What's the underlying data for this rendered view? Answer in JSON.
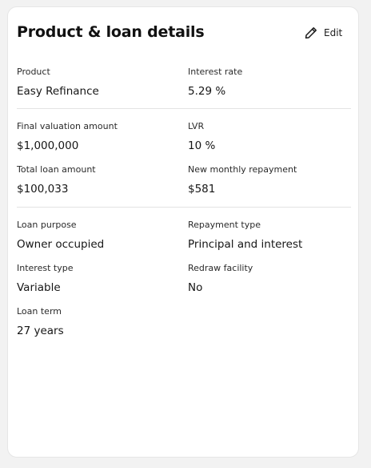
{
  "card": {
    "title": "Product & loan details",
    "edit_label": "Edit"
  },
  "sections": [
    {
      "fields": [
        {
          "label": "Product",
          "value": "Easy Refinance"
        },
        {
          "label": "Interest rate",
          "value": "5.29 %"
        }
      ]
    },
    {
      "fields": [
        {
          "label": "Final valuation amount",
          "value": "$1,000,000"
        },
        {
          "label": "LVR",
          "value": "10 %"
        },
        {
          "label": "Total loan amount",
          "value": "$100,033"
        },
        {
          "label": "New monthly repayment",
          "value": "$581"
        }
      ]
    },
    {
      "fields": [
        {
          "label": "Loan purpose",
          "value": "Owner occupied"
        },
        {
          "label": "Repayment type",
          "value": "Principal and interest"
        },
        {
          "label": "Interest type",
          "value": "Variable"
        },
        {
          "label": "Redraw facility",
          "value": "No"
        },
        {
          "label": "Loan term",
          "value": "27 years"
        }
      ]
    }
  ],
  "icons": {
    "edit": "pencil-icon"
  },
  "colors": {
    "background": "#f2f2f2",
    "card": "#ffffff",
    "text": "#161616",
    "divider": "#e3e3e3"
  }
}
